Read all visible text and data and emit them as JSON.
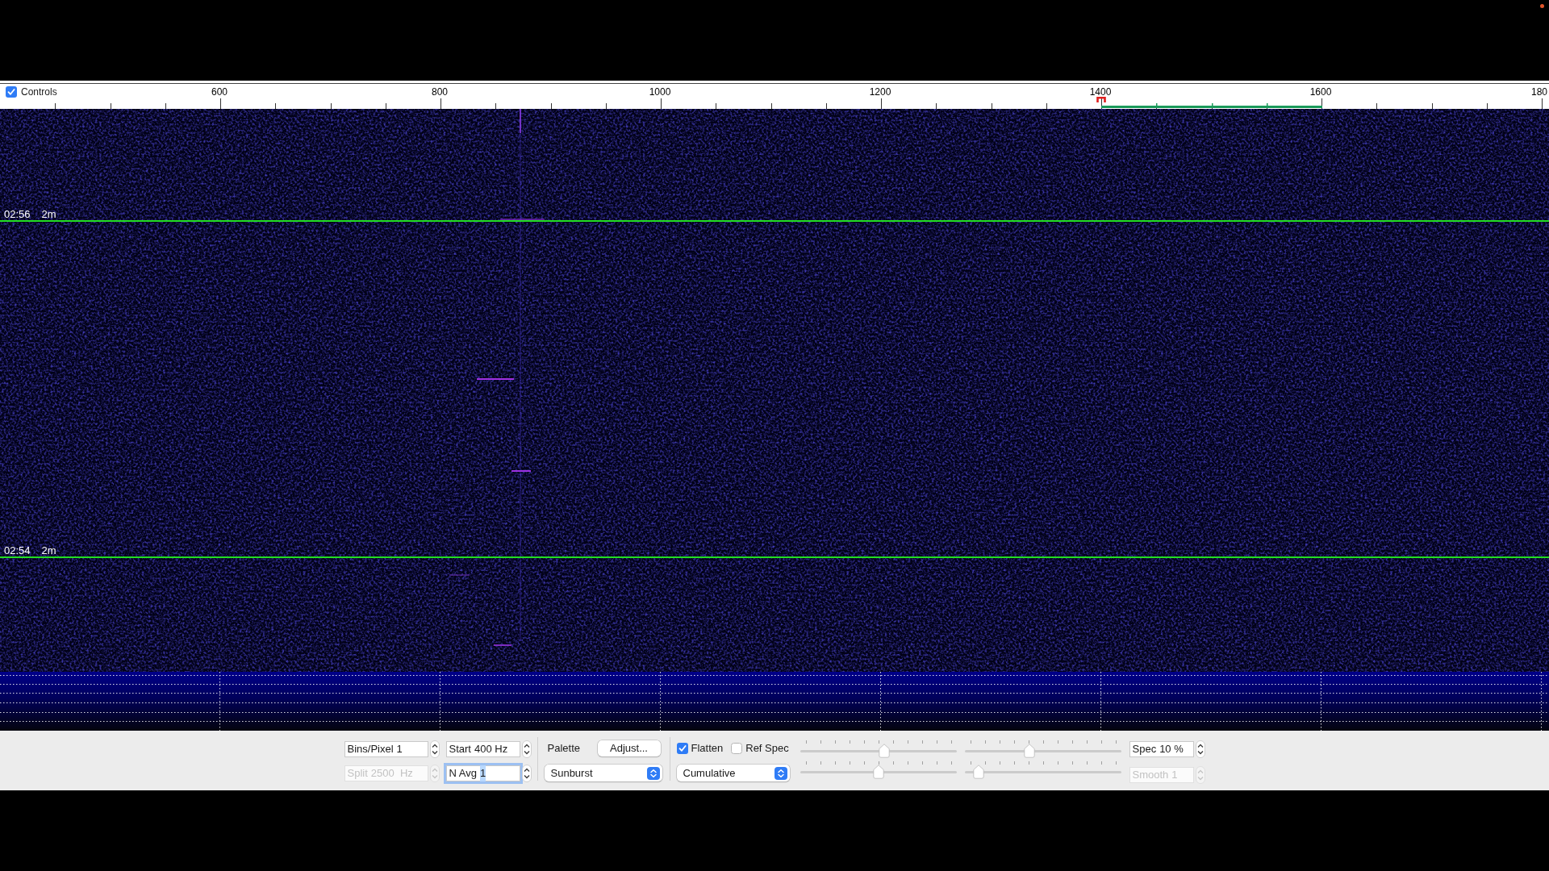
{
  "ruler": {
    "checkbox": {
      "label": "Controls",
      "checked": true
    },
    "labels": [
      "600",
      "800",
      "1000",
      "1200",
      "1400",
      "1600",
      "180"
    ]
  },
  "waterfall": {
    "time_markers": [
      {
        "time": "02:56",
        "span": "2m"
      },
      {
        "time": "02:54",
        "span": "2m"
      }
    ]
  },
  "controls": {
    "fields": [
      {
        "label": "Bins/Pixel",
        "value": "1",
        "disabled": false,
        "focused": false
      },
      {
        "label": "Start",
        "value": "400 Hz",
        "disabled": false,
        "focused": false
      },
      {
        "label": "Split",
        "value": "2500  Hz",
        "disabled": true,
        "focused": false
      },
      {
        "label": "N Avg",
        "value": "1",
        "disabled": false,
        "focused": true
      }
    ],
    "palette": {
      "label": "Palette",
      "button": "Adjust...",
      "popup": "Sunburst"
    },
    "checkboxes": [
      {
        "label": "Flatten",
        "checked": true
      },
      {
        "label": "Ref Spec",
        "checked": false
      }
    ],
    "mode_popup": "Cumulative",
    "sliders": [
      {
        "level": 0.54
      },
      {
        "level": 0.41
      },
      {
        "level": 0.5
      },
      {
        "level": 0.06
      }
    ],
    "side_fields": [
      {
        "label": "Spec",
        "value": "10 %",
        "disabled": false,
        "focused": false
      },
      {
        "label": "Smooth",
        "value": "1",
        "disabled": true,
        "focused": false
      }
    ]
  }
}
